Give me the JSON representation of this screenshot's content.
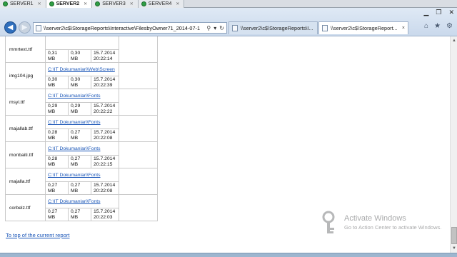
{
  "rdp_tabs": [
    {
      "label": "SERVER1"
    },
    {
      "label": "SERVER2"
    },
    {
      "label": "SERVER3"
    },
    {
      "label": "SERVER4"
    }
  ],
  "browser": {
    "address": "\\\\server2\\c$\\StorageReports\\Interactive\\FilesbyOwner71_2014-07-1",
    "tabs": [
      {
        "label": "\\\\server2\\c$\\StorageReports\\I..."
      },
      {
        "label": "\\\\server2\\c$\\StorageReport..."
      }
    ],
    "close_glyph": "×"
  },
  "report": {
    "rows": [
      {
        "file": "mmrtext.ttf",
        "path": "",
        "size1": "0,31 MB",
        "size2": "0,30 MB",
        "date": "15.7.2014",
        "time": "20:22:14"
      },
      {
        "file": "img104.jpg",
        "path": "C:\\IT Dokumanlari\\Web\\Screen",
        "size1": "0,30 MB",
        "size2": "0,30 MB",
        "date": "15.7.2014",
        "time": "20:22:39"
      },
      {
        "file": "msyi.ttf",
        "path": "C:\\IT Dokumanlari\\Fonts",
        "size1": "0,29 MB",
        "size2": "0,29 MB",
        "date": "15.7.2014",
        "time": "20:22:22"
      },
      {
        "file": "majallab.ttf",
        "path": "C:\\IT Dokumanlari\\Fonts",
        "size1": "0,28 MB",
        "size2": "0,27 MB",
        "date": "15.7.2014",
        "time": "20:22:08"
      },
      {
        "file": "monbaiti.ttf",
        "path": "C:\\IT Dokumanlari\\Fonts",
        "size1": "0,28 MB",
        "size2": "0,27 MB",
        "date": "15.7.2014",
        "time": "20:22:15"
      },
      {
        "file": "majalla.ttf",
        "path": "C:\\IT Dokumanlari\\Fonts",
        "size1": "0,27 MB",
        "size2": "0,27 MB",
        "date": "15.7.2014",
        "time": "20:22:08"
      },
      {
        "file": "corbelz.ttf",
        "path": "C:\\IT Dokumanlari\\Fonts",
        "size1": "0,27 MB",
        "size2": "0,27 MB",
        "date": "15.7.2014",
        "time": "20:22:03"
      }
    ],
    "top_link": "To top of the current report"
  },
  "watermark": {
    "title": "Activate Windows",
    "subtitle": "Go to Action Center to activate Windows."
  }
}
